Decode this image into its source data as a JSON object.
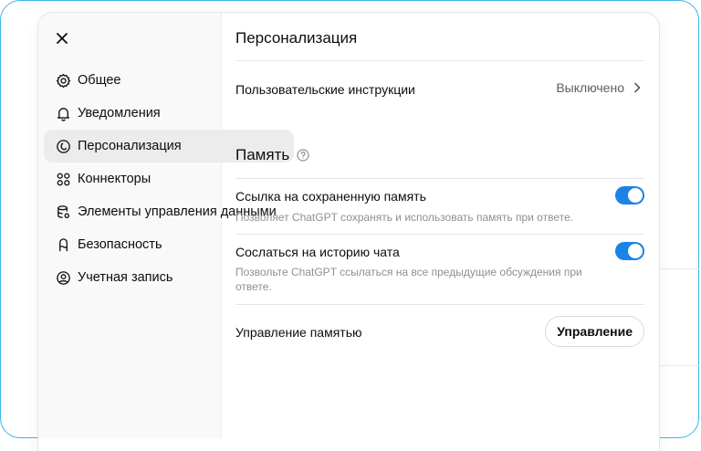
{
  "sidebar": {
    "items": [
      {
        "label": "Общее",
        "icon": "gear-icon"
      },
      {
        "label": "Уведомления",
        "icon": "bell-icon"
      },
      {
        "label": "Персонализация",
        "icon": "personalization-icon"
      },
      {
        "label": "Коннекторы",
        "icon": "connectors-icon"
      },
      {
        "label": "Элементы управления данными",
        "icon": "database-icon"
      },
      {
        "label": "Безопасность",
        "icon": "lock-icon"
      },
      {
        "label": "Учетная запись",
        "icon": "account-icon"
      }
    ],
    "active_index": 2
  },
  "main": {
    "title": "Персонализация",
    "custom_instructions": {
      "label": "Пользовательские инструкции",
      "value": "Выключено"
    },
    "memory": {
      "title": "Память",
      "saved_memory": {
        "label": "Ссылка на сохраненную память",
        "description": "Позволяет ChatGPT сохранять и использовать память при ответе.",
        "enabled": true
      },
      "chat_history": {
        "label": "Сослаться на историю чата",
        "description": "Позвольте ChatGPT ссылаться на все предыдущие обсуждения при ответе.",
        "enabled": true
      },
      "manage": {
        "label": "Управление памятью",
        "button": "Управление"
      }
    }
  },
  "colors": {
    "accent": "#1b82e8",
    "frame": "#40b4e8",
    "sidebar_bg": "#f9f9f9",
    "active_bg": "#ececec"
  }
}
